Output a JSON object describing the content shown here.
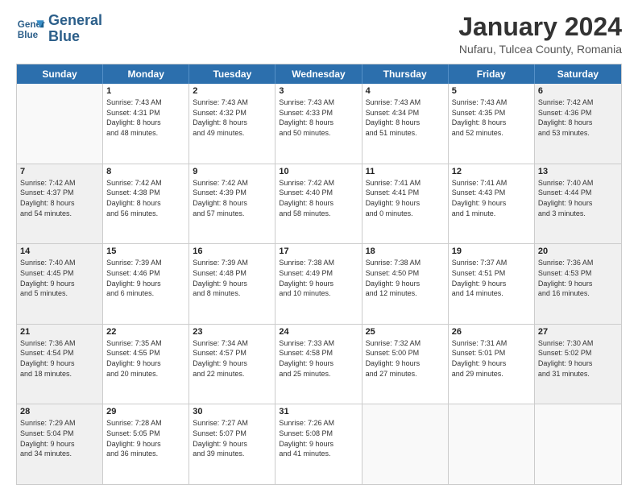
{
  "logo": {
    "line1": "General",
    "line2": "Blue"
  },
  "header": {
    "title": "January 2024",
    "subtitle": "Nufaru, Tulcea County, Romania"
  },
  "weekdays": [
    "Sunday",
    "Monday",
    "Tuesday",
    "Wednesday",
    "Thursday",
    "Friday",
    "Saturday"
  ],
  "weeks": [
    [
      {
        "day": "",
        "info": ""
      },
      {
        "day": "1",
        "info": "Sunrise: 7:43 AM\nSunset: 4:31 PM\nDaylight: 8 hours\nand 48 minutes."
      },
      {
        "day": "2",
        "info": "Sunrise: 7:43 AM\nSunset: 4:32 PM\nDaylight: 8 hours\nand 49 minutes."
      },
      {
        "day": "3",
        "info": "Sunrise: 7:43 AM\nSunset: 4:33 PM\nDaylight: 8 hours\nand 50 minutes."
      },
      {
        "day": "4",
        "info": "Sunrise: 7:43 AM\nSunset: 4:34 PM\nDaylight: 8 hours\nand 51 minutes."
      },
      {
        "day": "5",
        "info": "Sunrise: 7:43 AM\nSunset: 4:35 PM\nDaylight: 8 hours\nand 52 minutes."
      },
      {
        "day": "6",
        "info": "Sunrise: 7:42 AM\nSunset: 4:36 PM\nDaylight: 8 hours\nand 53 minutes."
      }
    ],
    [
      {
        "day": "7",
        "info": "Sunrise: 7:42 AM\nSunset: 4:37 PM\nDaylight: 8 hours\nand 54 minutes."
      },
      {
        "day": "8",
        "info": "Sunrise: 7:42 AM\nSunset: 4:38 PM\nDaylight: 8 hours\nand 56 minutes."
      },
      {
        "day": "9",
        "info": "Sunrise: 7:42 AM\nSunset: 4:39 PM\nDaylight: 8 hours\nand 57 minutes."
      },
      {
        "day": "10",
        "info": "Sunrise: 7:42 AM\nSunset: 4:40 PM\nDaylight: 8 hours\nand 58 minutes."
      },
      {
        "day": "11",
        "info": "Sunrise: 7:41 AM\nSunset: 4:41 PM\nDaylight: 9 hours\nand 0 minutes."
      },
      {
        "day": "12",
        "info": "Sunrise: 7:41 AM\nSunset: 4:43 PM\nDaylight: 9 hours\nand 1 minute."
      },
      {
        "day": "13",
        "info": "Sunrise: 7:40 AM\nSunset: 4:44 PM\nDaylight: 9 hours\nand 3 minutes."
      }
    ],
    [
      {
        "day": "14",
        "info": "Sunrise: 7:40 AM\nSunset: 4:45 PM\nDaylight: 9 hours\nand 5 minutes."
      },
      {
        "day": "15",
        "info": "Sunrise: 7:39 AM\nSunset: 4:46 PM\nDaylight: 9 hours\nand 6 minutes."
      },
      {
        "day": "16",
        "info": "Sunrise: 7:39 AM\nSunset: 4:48 PM\nDaylight: 9 hours\nand 8 minutes."
      },
      {
        "day": "17",
        "info": "Sunrise: 7:38 AM\nSunset: 4:49 PM\nDaylight: 9 hours\nand 10 minutes."
      },
      {
        "day": "18",
        "info": "Sunrise: 7:38 AM\nSunset: 4:50 PM\nDaylight: 9 hours\nand 12 minutes."
      },
      {
        "day": "19",
        "info": "Sunrise: 7:37 AM\nSunset: 4:51 PM\nDaylight: 9 hours\nand 14 minutes."
      },
      {
        "day": "20",
        "info": "Sunrise: 7:36 AM\nSunset: 4:53 PM\nDaylight: 9 hours\nand 16 minutes."
      }
    ],
    [
      {
        "day": "21",
        "info": "Sunrise: 7:36 AM\nSunset: 4:54 PM\nDaylight: 9 hours\nand 18 minutes."
      },
      {
        "day": "22",
        "info": "Sunrise: 7:35 AM\nSunset: 4:55 PM\nDaylight: 9 hours\nand 20 minutes."
      },
      {
        "day": "23",
        "info": "Sunrise: 7:34 AM\nSunset: 4:57 PM\nDaylight: 9 hours\nand 22 minutes."
      },
      {
        "day": "24",
        "info": "Sunrise: 7:33 AM\nSunset: 4:58 PM\nDaylight: 9 hours\nand 25 minutes."
      },
      {
        "day": "25",
        "info": "Sunrise: 7:32 AM\nSunset: 5:00 PM\nDaylight: 9 hours\nand 27 minutes."
      },
      {
        "day": "26",
        "info": "Sunrise: 7:31 AM\nSunset: 5:01 PM\nDaylight: 9 hours\nand 29 minutes."
      },
      {
        "day": "27",
        "info": "Sunrise: 7:30 AM\nSunset: 5:02 PM\nDaylight: 9 hours\nand 31 minutes."
      }
    ],
    [
      {
        "day": "28",
        "info": "Sunrise: 7:29 AM\nSunset: 5:04 PM\nDaylight: 9 hours\nand 34 minutes."
      },
      {
        "day": "29",
        "info": "Sunrise: 7:28 AM\nSunset: 5:05 PM\nDaylight: 9 hours\nand 36 minutes."
      },
      {
        "day": "30",
        "info": "Sunrise: 7:27 AM\nSunset: 5:07 PM\nDaylight: 9 hours\nand 39 minutes."
      },
      {
        "day": "31",
        "info": "Sunrise: 7:26 AM\nSunset: 5:08 PM\nDaylight: 9 hours\nand 41 minutes."
      },
      {
        "day": "",
        "info": ""
      },
      {
        "day": "",
        "info": ""
      },
      {
        "day": "",
        "info": ""
      }
    ]
  ]
}
